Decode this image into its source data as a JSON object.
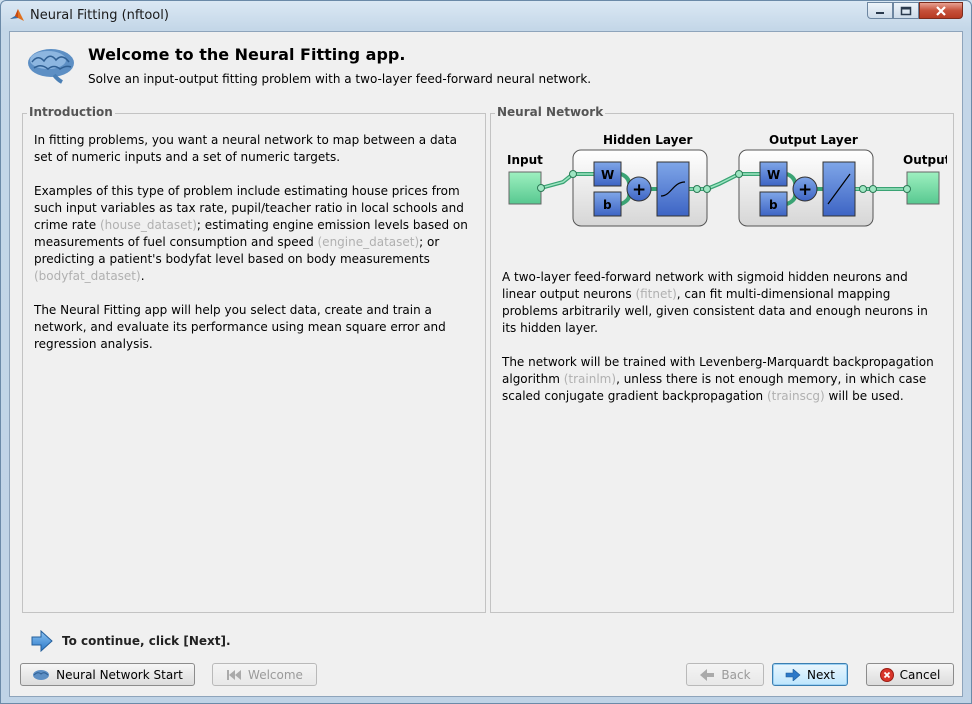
{
  "window": {
    "title": "Neural Fitting (nftool)"
  },
  "header": {
    "title": "Welcome to the Neural Fitting app.",
    "subtitle": "Solve an input-output fitting problem with a two-layer feed-forward neural network."
  },
  "intro": {
    "label": "Introduction",
    "p1": "In fitting problems, you want a neural network to map between a data set of numeric inputs and a set of numeric targets.",
    "p2_a": "Examples of this type of problem include estimating house prices from such input variables as tax rate, pupil/teacher ratio in local schools and crime rate ",
    "p2_link1": "(house_dataset)",
    "p2_b": "; estimating engine emission levels based on measurements of fuel consumption and speed ",
    "p2_link2": "(engine_dataset)",
    "p2_c": "; or predicting a patient's bodyfat level based on body measurements ",
    "p2_link3": "(bodyfat_dataset)",
    "p2_d": ".",
    "p3": "The Neural Fitting app will help you select data, create and train a network, and evaluate its performance using mean square error and regression analysis."
  },
  "network": {
    "label": "Neural Network",
    "diagram": {
      "input": "Input",
      "hidden": "Hidden Layer",
      "output_layer": "Output Layer",
      "output": "Output",
      "w": "W",
      "b": "b"
    },
    "p1_a": "A two-layer feed-forward network with sigmoid hidden neurons and linear output neurons ",
    "p1_link": "(fitnet)",
    "p1_b": ", can fit multi-dimensional mapping problems arbitrarily well, given consistent data and enough neurons in its hidden layer.",
    "p2_a": "The network will be trained with Levenberg-Marquardt backpropagation algorithm ",
    "p2_link1": "(trainlm)",
    "p2_b": ", unless there is not enough memory, in which case scaled conjugate gradient backpropagation ",
    "p2_link2": "(trainscg)",
    "p2_c": " will be used."
  },
  "footer": {
    "continue": "To continue, click [Next].",
    "buttons": {
      "start": "Neural Network Start",
      "welcome": "Welcome",
      "back": "Back",
      "next": "Next",
      "cancel": "Cancel"
    }
  }
}
